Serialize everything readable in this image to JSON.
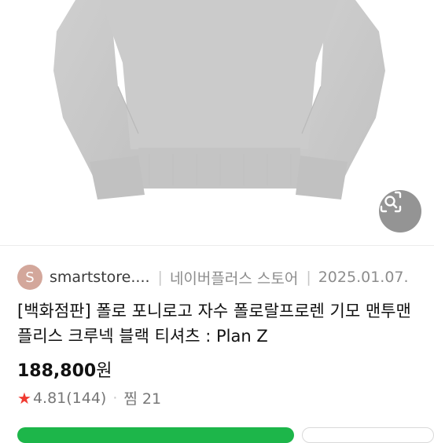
{
  "store": {
    "avatar_letter": "S",
    "name": "smartstore....",
    "separator": "|",
    "type": "네이버플러스 스토어",
    "date": "2025.01.07."
  },
  "product": {
    "title": "[백화점판] 폴로 포니로고 자수 폴로랄프로렌 기모 맨투맨 플리스 크루넥 블랙 티셔츠 : Plan Z",
    "price": "188,800",
    "price_unit": "원",
    "rating_star": "★",
    "rating": "4.81",
    "review_count": "(144)",
    "meta_dot": "·",
    "wishlist": "찜 21"
  },
  "icons": {
    "lens": "image-search-icon",
    "star": "star-icon"
  },
  "colors": {
    "garment": "#c9c9c9",
    "avatar": "#d3a79b",
    "star": "#f03a31",
    "buy_button": "#1db64a",
    "lens_button": "#8b8b8b"
  }
}
